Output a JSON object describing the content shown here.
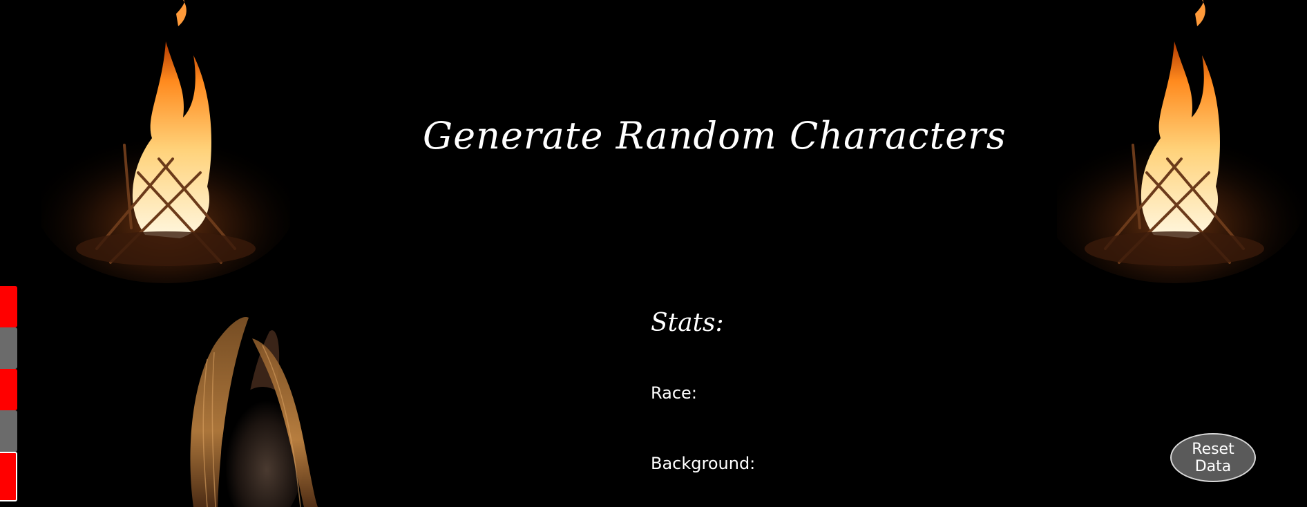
{
  "header": {
    "title": "Generate Random Characters"
  },
  "stats": {
    "heading": "Stats:",
    "race_label": "Race:",
    "background_label": "Background:"
  },
  "side_tabs": [
    {
      "color": "#ff0000"
    },
    {
      "color": "#6b6b6b"
    },
    {
      "color": "#ff0000"
    },
    {
      "color": "#6b6b6b"
    },
    {
      "color": "#ff0000",
      "active": true
    }
  ],
  "actions": {
    "reset_label": "Reset Data"
  },
  "colors": {
    "background": "#000000",
    "text": "#ffffff",
    "tab_red": "#ff0000",
    "tab_gray": "#6b6b6b",
    "button_bg": "#5a5a5a"
  },
  "images": {
    "left_fire": "campfire-image",
    "right_fire": "campfire-image",
    "portrait": "horse-portrait-image"
  }
}
